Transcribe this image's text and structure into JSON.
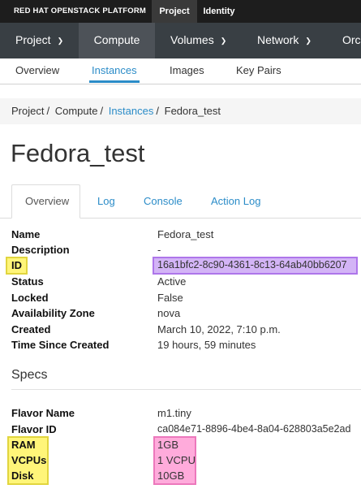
{
  "header": {
    "brand": "RED HAT OPENSTACK PLATFORM",
    "tabs": [
      "Project",
      "Identity"
    ],
    "active_tab": "Project"
  },
  "main_nav": {
    "items": [
      {
        "label": "Project",
        "has_dropdown": true
      },
      {
        "label": "Compute",
        "has_dropdown": false,
        "active": true
      },
      {
        "label": "Volumes",
        "has_dropdown": true
      },
      {
        "label": "Network",
        "has_dropdown": true
      },
      {
        "label": "Orc"
      }
    ]
  },
  "sub_nav": {
    "items": [
      "Overview",
      "Instances",
      "Images",
      "Key Pairs"
    ],
    "active": "Instances"
  },
  "breadcrumb": {
    "items": [
      "Project",
      "Compute",
      "Instances",
      "Fedora_test"
    ],
    "separator": "/"
  },
  "page_title": "Fedora_test",
  "detail_tabs": {
    "items": [
      "Overview",
      "Log",
      "Console",
      "Action Log"
    ],
    "active": "Overview"
  },
  "overview": {
    "rows": [
      {
        "label": "Name",
        "value": "Fedora_test"
      },
      {
        "label": "Description",
        "value": "-"
      },
      {
        "label": "ID",
        "value": "16a1bfc2-8c90-4361-8c13-64ab40bb6207"
      },
      {
        "label": "Status",
        "value": "Active"
      },
      {
        "label": "Locked",
        "value": "False"
      },
      {
        "label": "Availability Zone",
        "value": "nova"
      },
      {
        "label": "Created",
        "value": "March 10, 2022, 7:10 p.m."
      },
      {
        "label": "Time Since Created",
        "value": "19 hours, 59 minutes"
      }
    ]
  },
  "specs": {
    "heading": "Specs",
    "rows": [
      {
        "label": "Flavor Name",
        "value": "m1.tiny"
      },
      {
        "label": "Flavor ID",
        "value": "ca084e71-8896-4be4-8a04-628803a5e2ad"
      },
      {
        "label": "RAM",
        "value": "1GB"
      },
      {
        "label": "VCPUs",
        "value": "1 VCPU"
      },
      {
        "label": "Disk",
        "value": "10GB"
      }
    ]
  },
  "colors": {
    "link": "#2b8cc8",
    "highlight_yellow": "#fff24d",
    "highlight_purple": "#c9a2f5",
    "highlight_pink": "#ff8fd0"
  }
}
